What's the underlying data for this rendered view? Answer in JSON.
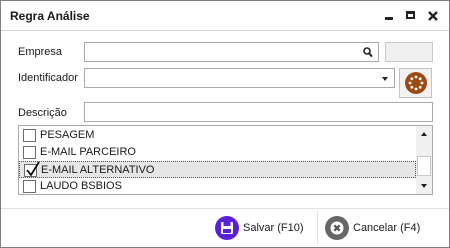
{
  "window": {
    "title": "Regra Análise",
    "controls": {
      "minimize_icon": "minimize-icon",
      "maximize_icon": "maximize-icon",
      "close_icon": "close-icon"
    }
  },
  "form": {
    "empresa": {
      "label": "Empresa",
      "value": "",
      "icon": "search-icon"
    },
    "identificador": {
      "label": "Identificador",
      "value": "",
      "icon": "chevron-down-icon"
    },
    "descricao": {
      "label": "Descrição",
      "value": ""
    }
  },
  "list": {
    "items": [
      {
        "label": "PESAGEM",
        "checked": false
      },
      {
        "label": "E-MAIL PARCEIRO",
        "checked": false
      },
      {
        "label": "E-MAIL ALTERNATIVO",
        "checked": true
      },
      {
        "label": "LAUDO BSBIOS",
        "checked": false
      }
    ]
  },
  "footer": {
    "save_label": "Salvar (F10)",
    "cancel_label": "Cancelar (F4)"
  },
  "colors": {
    "save_accent": "#5a1fd6",
    "cancel_accent": "#666666",
    "action_button": "#9b4a12"
  }
}
